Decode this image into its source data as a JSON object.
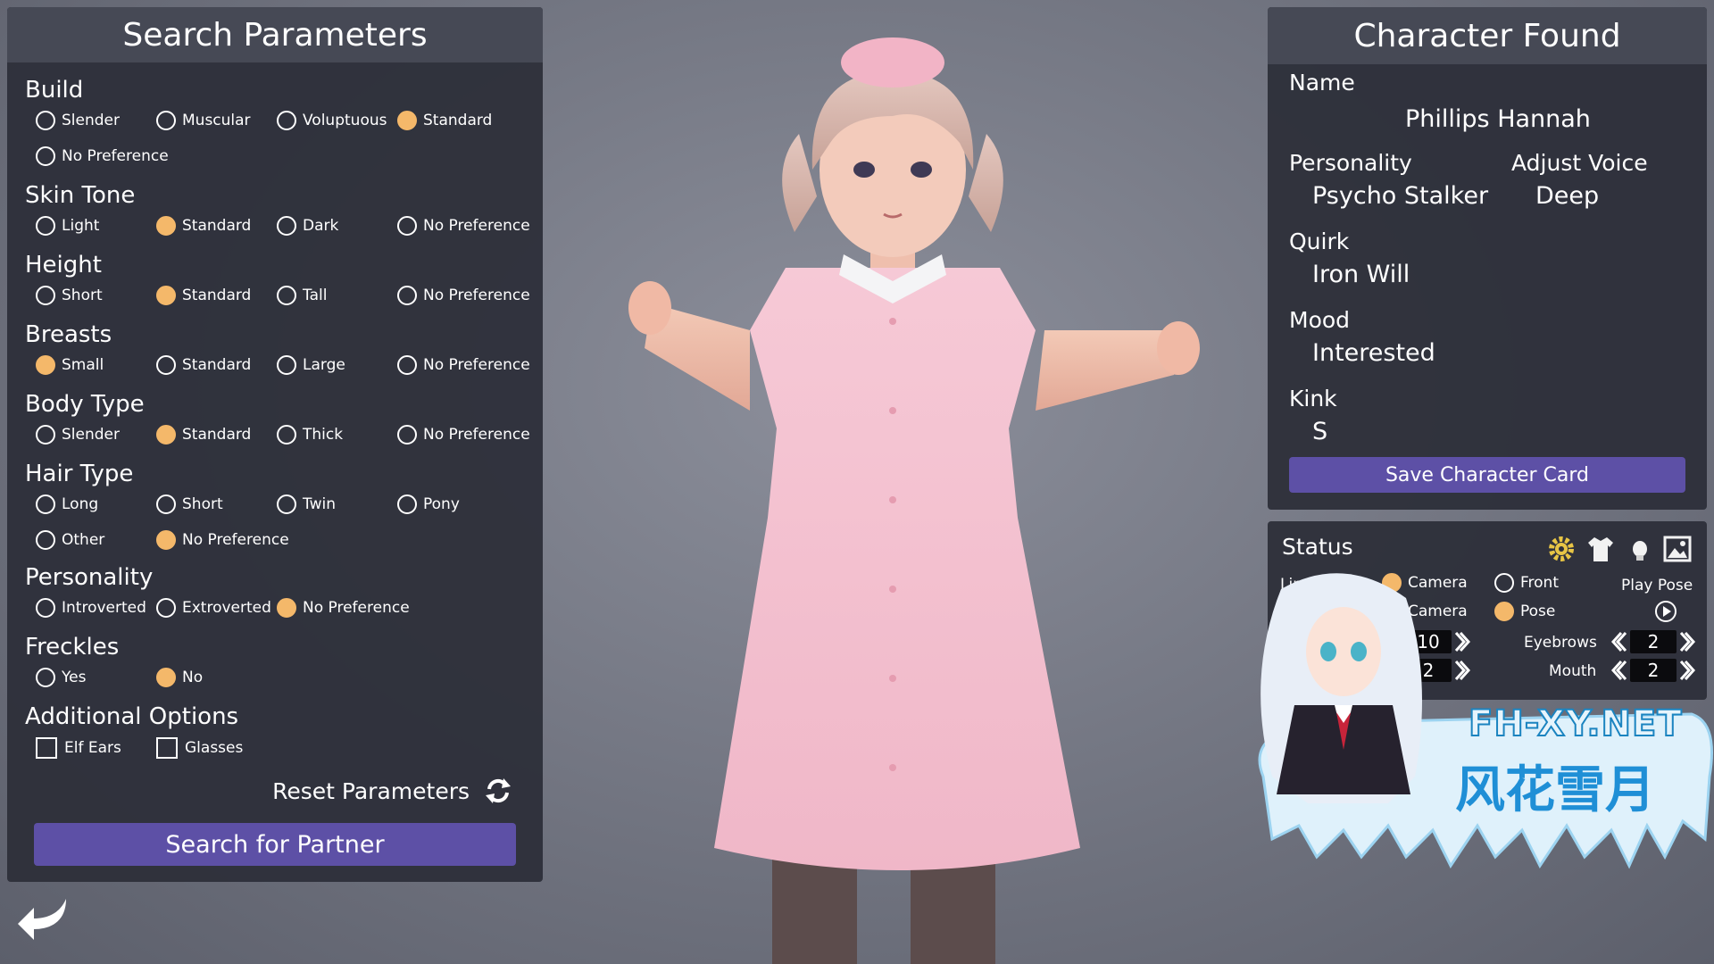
{
  "search": {
    "title": "Search Parameters",
    "sections": {
      "build": {
        "title": "Build",
        "options": [
          {
            "label": "Slender",
            "selected": false
          },
          {
            "label": "Muscular",
            "selected": false
          },
          {
            "label": "Voluptuous",
            "selected": false
          },
          {
            "label": "Standard",
            "selected": true
          },
          {
            "label": "No Preference",
            "selected": false
          }
        ]
      },
      "skin_tone": {
        "title": "Skin Tone",
        "options": [
          {
            "label": "Light",
            "selected": false
          },
          {
            "label": "Standard",
            "selected": true
          },
          {
            "label": "Dark",
            "selected": false
          },
          {
            "label": "No Preference",
            "selected": false
          }
        ]
      },
      "height": {
        "title": "Height",
        "options": [
          {
            "label": "Short",
            "selected": false
          },
          {
            "label": "Standard",
            "selected": true
          },
          {
            "label": "Tall",
            "selected": false
          },
          {
            "label": "No Preference",
            "selected": false
          }
        ]
      },
      "breasts": {
        "title": "Breasts",
        "options": [
          {
            "label": "Small",
            "selected": true
          },
          {
            "label": "Standard",
            "selected": false
          },
          {
            "label": "Large",
            "selected": false
          },
          {
            "label": "No Preference",
            "selected": false
          }
        ]
      },
      "body_type": {
        "title": "Body Type",
        "options": [
          {
            "label": "Slender",
            "selected": false
          },
          {
            "label": "Standard",
            "selected": true
          },
          {
            "label": "Thick",
            "selected": false
          },
          {
            "label": "No Preference",
            "selected": false
          }
        ]
      },
      "hair_type": {
        "title": "Hair Type",
        "options": [
          {
            "label": "Long",
            "selected": false
          },
          {
            "label": "Short",
            "selected": false
          },
          {
            "label": "Twin",
            "selected": false
          },
          {
            "label": "Pony",
            "selected": false
          },
          {
            "label": "Other",
            "selected": false
          },
          {
            "label": "No Preference",
            "selected": true
          }
        ]
      },
      "personality": {
        "title": "Personality",
        "options": [
          {
            "label": "Introverted",
            "selected": false
          },
          {
            "label": "Extroverted",
            "selected": false
          },
          {
            "label": "No Preference",
            "selected": true
          }
        ]
      },
      "freckles": {
        "title": "Freckles",
        "options": [
          {
            "label": "Yes",
            "selected": false
          },
          {
            "label": "No",
            "selected": true
          }
        ]
      },
      "additional": {
        "title": "Additional Options",
        "options": [
          {
            "label": "Elf Ears",
            "checked": false
          },
          {
            "label": "Glasses",
            "checked": false
          }
        ]
      }
    },
    "reset_label": "Reset Parameters",
    "search_button": "Search for Partner"
  },
  "character": {
    "title": "Character Found",
    "name_label": "Name",
    "name": "Phillips Hannah",
    "personality_label": "Personality",
    "personality": "Psycho Stalker",
    "voice_label": "Adjust Voice",
    "voice": "Deep",
    "quirk_label": "Quirk",
    "quirk": "Iron Will",
    "mood_label": "Mood",
    "mood": "Interested",
    "kink_label": "Kink",
    "kink": "S",
    "save_button": "Save Character Card"
  },
  "status": {
    "title": "Status",
    "line_label_partial": "Lin",
    "camera_label_1": "Camera",
    "camera_label_2": "Camera",
    "camera_1_selected": true,
    "camera_2_selected": false,
    "front_label": "Front",
    "front_selected": false,
    "pose_label": "Pose",
    "pose_selected": true,
    "play_pose_label": "Play Pose",
    "value_1": "10",
    "value_2": "2",
    "eyebrows_label": "Eyebrows",
    "eyebrows_value": "2",
    "mouth_label": "Mouth",
    "mouth_value": "2",
    "icons": [
      "gear-icon",
      "clothing-icon",
      "light-bulb-icon",
      "image-icon"
    ]
  },
  "watermark": {
    "site": "FH-XY.NET",
    "brand": "风花雪月"
  },
  "colors": {
    "accent_button": "#5d50a6",
    "radio_selected": "#f4b86a",
    "panel_bg": "#2e303a",
    "header_bg": "#464955"
  }
}
